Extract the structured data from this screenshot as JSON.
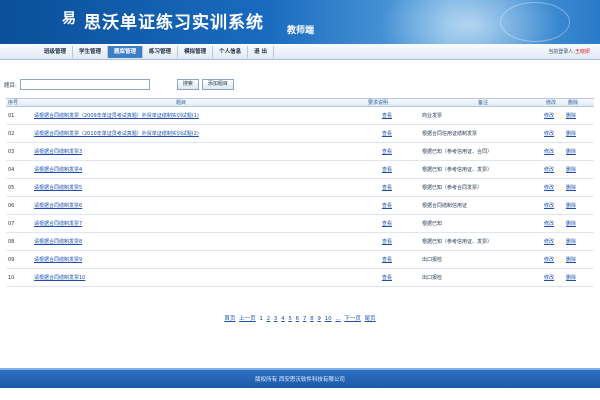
{
  "banner": {
    "logo_text": "易",
    "title": "思沃单证练习实训系统",
    "subtitle": "教师端"
  },
  "nav": {
    "items": [
      {
        "label": "班级管理",
        "active": false
      },
      {
        "label": "学生管理",
        "active": false
      },
      {
        "label": "题库管理",
        "active": true
      },
      {
        "label": "练习管理",
        "active": false
      },
      {
        "label": "模拟管理",
        "active": false
      },
      {
        "label": "个人信息",
        "active": false
      },
      {
        "label": "退 出",
        "active": false
      }
    ],
    "login_label": "当前登录人:",
    "login_user": "王晓妍"
  },
  "search": {
    "label": "题目:",
    "value": "",
    "placeholder": "",
    "search_button": "搜索",
    "add_button": "添加题目"
  },
  "table": {
    "headers": {
      "no": "序号",
      "name": "题目",
      "desc": "要求说明",
      "note": "备注",
      "edit": "修改",
      "delete": "删除"
    },
    "rows": [
      {
        "no": "01",
        "name": "请根据合同缮制发票（2009年单证员考试真题）外贸单证缮制实训试题(1)",
        "desc": "查看",
        "note": "商业发票",
        "edit": "修改",
        "delete": "删除"
      },
      {
        "no": "02",
        "name": "请根据合同缮制发票（2010年单证员考试真题）外贸单证缮制实训试题(2)",
        "desc": "查看",
        "note": "根据合同信用证缮制发票",
        "edit": "修改",
        "delete": "删除"
      },
      {
        "no": "03",
        "name": "请根据合同缮制发票3",
        "desc": "查看",
        "note": "根据已知（参考信用证、合同）",
        "edit": "修改",
        "delete": "删除"
      },
      {
        "no": "04",
        "name": "请根据合同缮制发票4",
        "desc": "查看",
        "note": "根据已知（参考信用证、发票）",
        "edit": "修改",
        "delete": "删除"
      },
      {
        "no": "05",
        "name": "请根据合同缮制发票5",
        "desc": "查看",
        "note": "根据已知（参考合同发票）",
        "edit": "修改",
        "delete": "删除"
      },
      {
        "no": "06",
        "name": "请根据合同缮制发票6",
        "desc": "查看",
        "note": "根据合同缮制信用证",
        "edit": "修改",
        "delete": "删除"
      },
      {
        "no": "07",
        "name": "请根据合同缮制发票7",
        "desc": "查看",
        "note": "根据已知",
        "edit": "修改",
        "delete": "删除"
      },
      {
        "no": "08",
        "name": "请根据合同缮制发票8",
        "desc": "查看",
        "note": "根据已知（参考信用证、发票）",
        "edit": "修改",
        "delete": "删除"
      },
      {
        "no": "09",
        "name": "请根据合同缮制发票9",
        "desc": "查看",
        "note": "出口报检",
        "edit": "修改",
        "delete": "删除"
      },
      {
        "no": "10",
        "name": "请根据合同缮制发票10",
        "desc": "查看",
        "note": "出口报检",
        "edit": "修改",
        "delete": "删除"
      }
    ]
  },
  "pager": {
    "first": "首页",
    "prev": "上一页",
    "pages": [
      "1",
      "2",
      "3",
      "4",
      "5",
      "6",
      "7",
      "8",
      "9",
      "10"
    ],
    "ellipsis": "...",
    "next": "下一页",
    "last": "尾页"
  },
  "footer": {
    "text": "版权所有 西安思沃软件科技有限公司"
  },
  "colors": {
    "banner": "#1a6cc0",
    "nav_active": "#3d7fc7",
    "link": "#1d4fae",
    "login_user": "#d61b1b",
    "footer": "#1a5aa8"
  }
}
